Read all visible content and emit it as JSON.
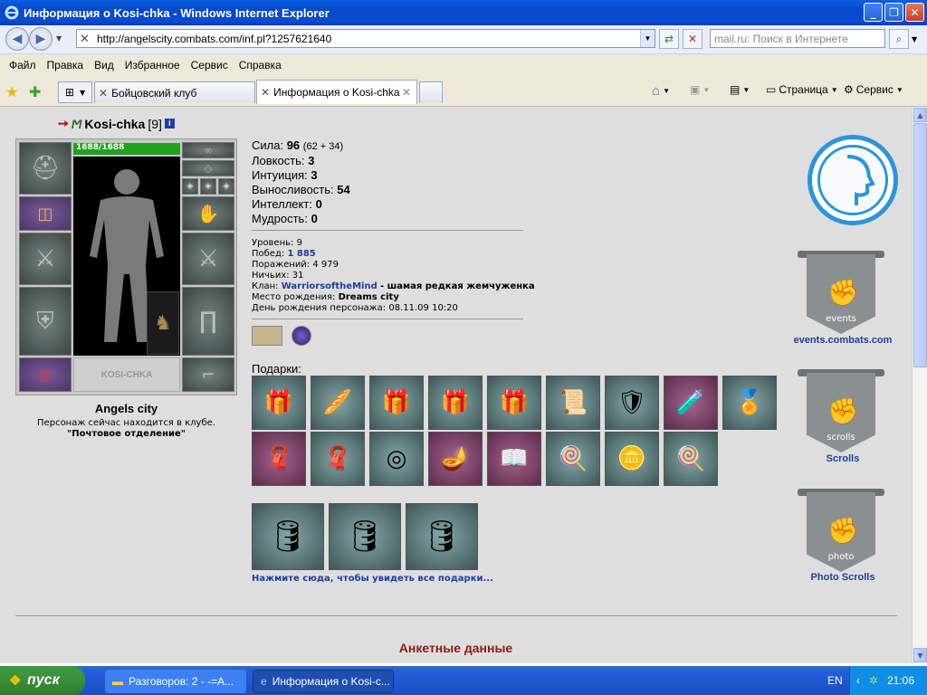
{
  "window": {
    "title": "Информация о Kosi-chka - Windows Internet Explorer"
  },
  "address": {
    "url": "http://angelscity.combats.com/inf.pl?1257621640",
    "search_placeholder": "mail.ru: Поиск в Интернете"
  },
  "menu": [
    "Файл",
    "Правка",
    "Вид",
    "Избранное",
    "Сервис",
    "Справка"
  ],
  "tabs": [
    {
      "label": "Бойцовский клуб"
    },
    {
      "label": "Информация о Kosi-chka"
    }
  ],
  "toolbar": {
    "page_label": "Страница",
    "tools_label": "Сервис"
  },
  "character": {
    "name": "Kosi-chka",
    "level_text": "[9]",
    "hp_text": "1688/1688",
    "hp_fraction": 1.0,
    "town": "Angels city",
    "location_line1": "Персонаж сейчас находится в клубе.",
    "location_line2": "\"Почтовое отделение\""
  },
  "stats": [
    {
      "label": "Сила:",
      "value": "96",
      "extra": "(62 + 34)"
    },
    {
      "label": "Ловкость:",
      "value": "3",
      "extra": ""
    },
    {
      "label": "Интуиция:",
      "value": "3",
      "extra": ""
    },
    {
      "label": "Выносливость:",
      "value": "54",
      "extra": ""
    },
    {
      "label": "Интеллект:",
      "value": "0",
      "extra": ""
    },
    {
      "label": "Мудрость:",
      "value": "0",
      "extra": ""
    }
  ],
  "info": {
    "level_label": "Уровень:",
    "level": "9",
    "wins_label": "Побед:",
    "wins": "1 885",
    "losses_label": "Поражений:",
    "losses": "4 979",
    "draws_label": "Ничьих:",
    "draws": "31",
    "clan_label": "Клан:",
    "clan": "WarriorsoftheMind",
    "clan_rank": "- шамая редкая жемчуженка",
    "birthplace_label": "Место рождения:",
    "birthplace": "Dreams city",
    "birthday_label": "День рождения персонажа:",
    "birthday": "08.11.09 10:20"
  },
  "gifts": {
    "label": "Подарки:",
    "all_link": "Нажмите сюда, чтобы увидеть все подарки...",
    "row1": [
      "gift-box",
      "bread",
      "gift-box",
      "gift-box",
      "gift-box",
      "scroll",
      "gold-mask",
      "perfume",
      "gem-medal"
    ],
    "row2": [
      "red-cape",
      "grey-cape",
      "target",
      "genie-lamp",
      "book",
      "lollipop",
      "coins",
      "lollipop"
    ],
    "row3": [
      "barrel",
      "barrel",
      "barrel"
    ]
  },
  "right": {
    "events_label": "events.combats.com",
    "events_banner": "events",
    "scrolls_label": "Scrolls",
    "scrolls_banner": "scrolls",
    "photo_label": "Photo Scrolls",
    "photo_banner": "photo"
  },
  "section_title": "Анкетные данные",
  "taskbar": {
    "start": "пуск",
    "item1": "Разговоров: 2 - -=А...",
    "item2": "Информация о Kosi-c...",
    "lang": "EN",
    "time": "21:06"
  },
  "colors": {
    "accent": "#2c95d8",
    "link": "#1f3f9e",
    "section": "#8b1a1a"
  }
}
